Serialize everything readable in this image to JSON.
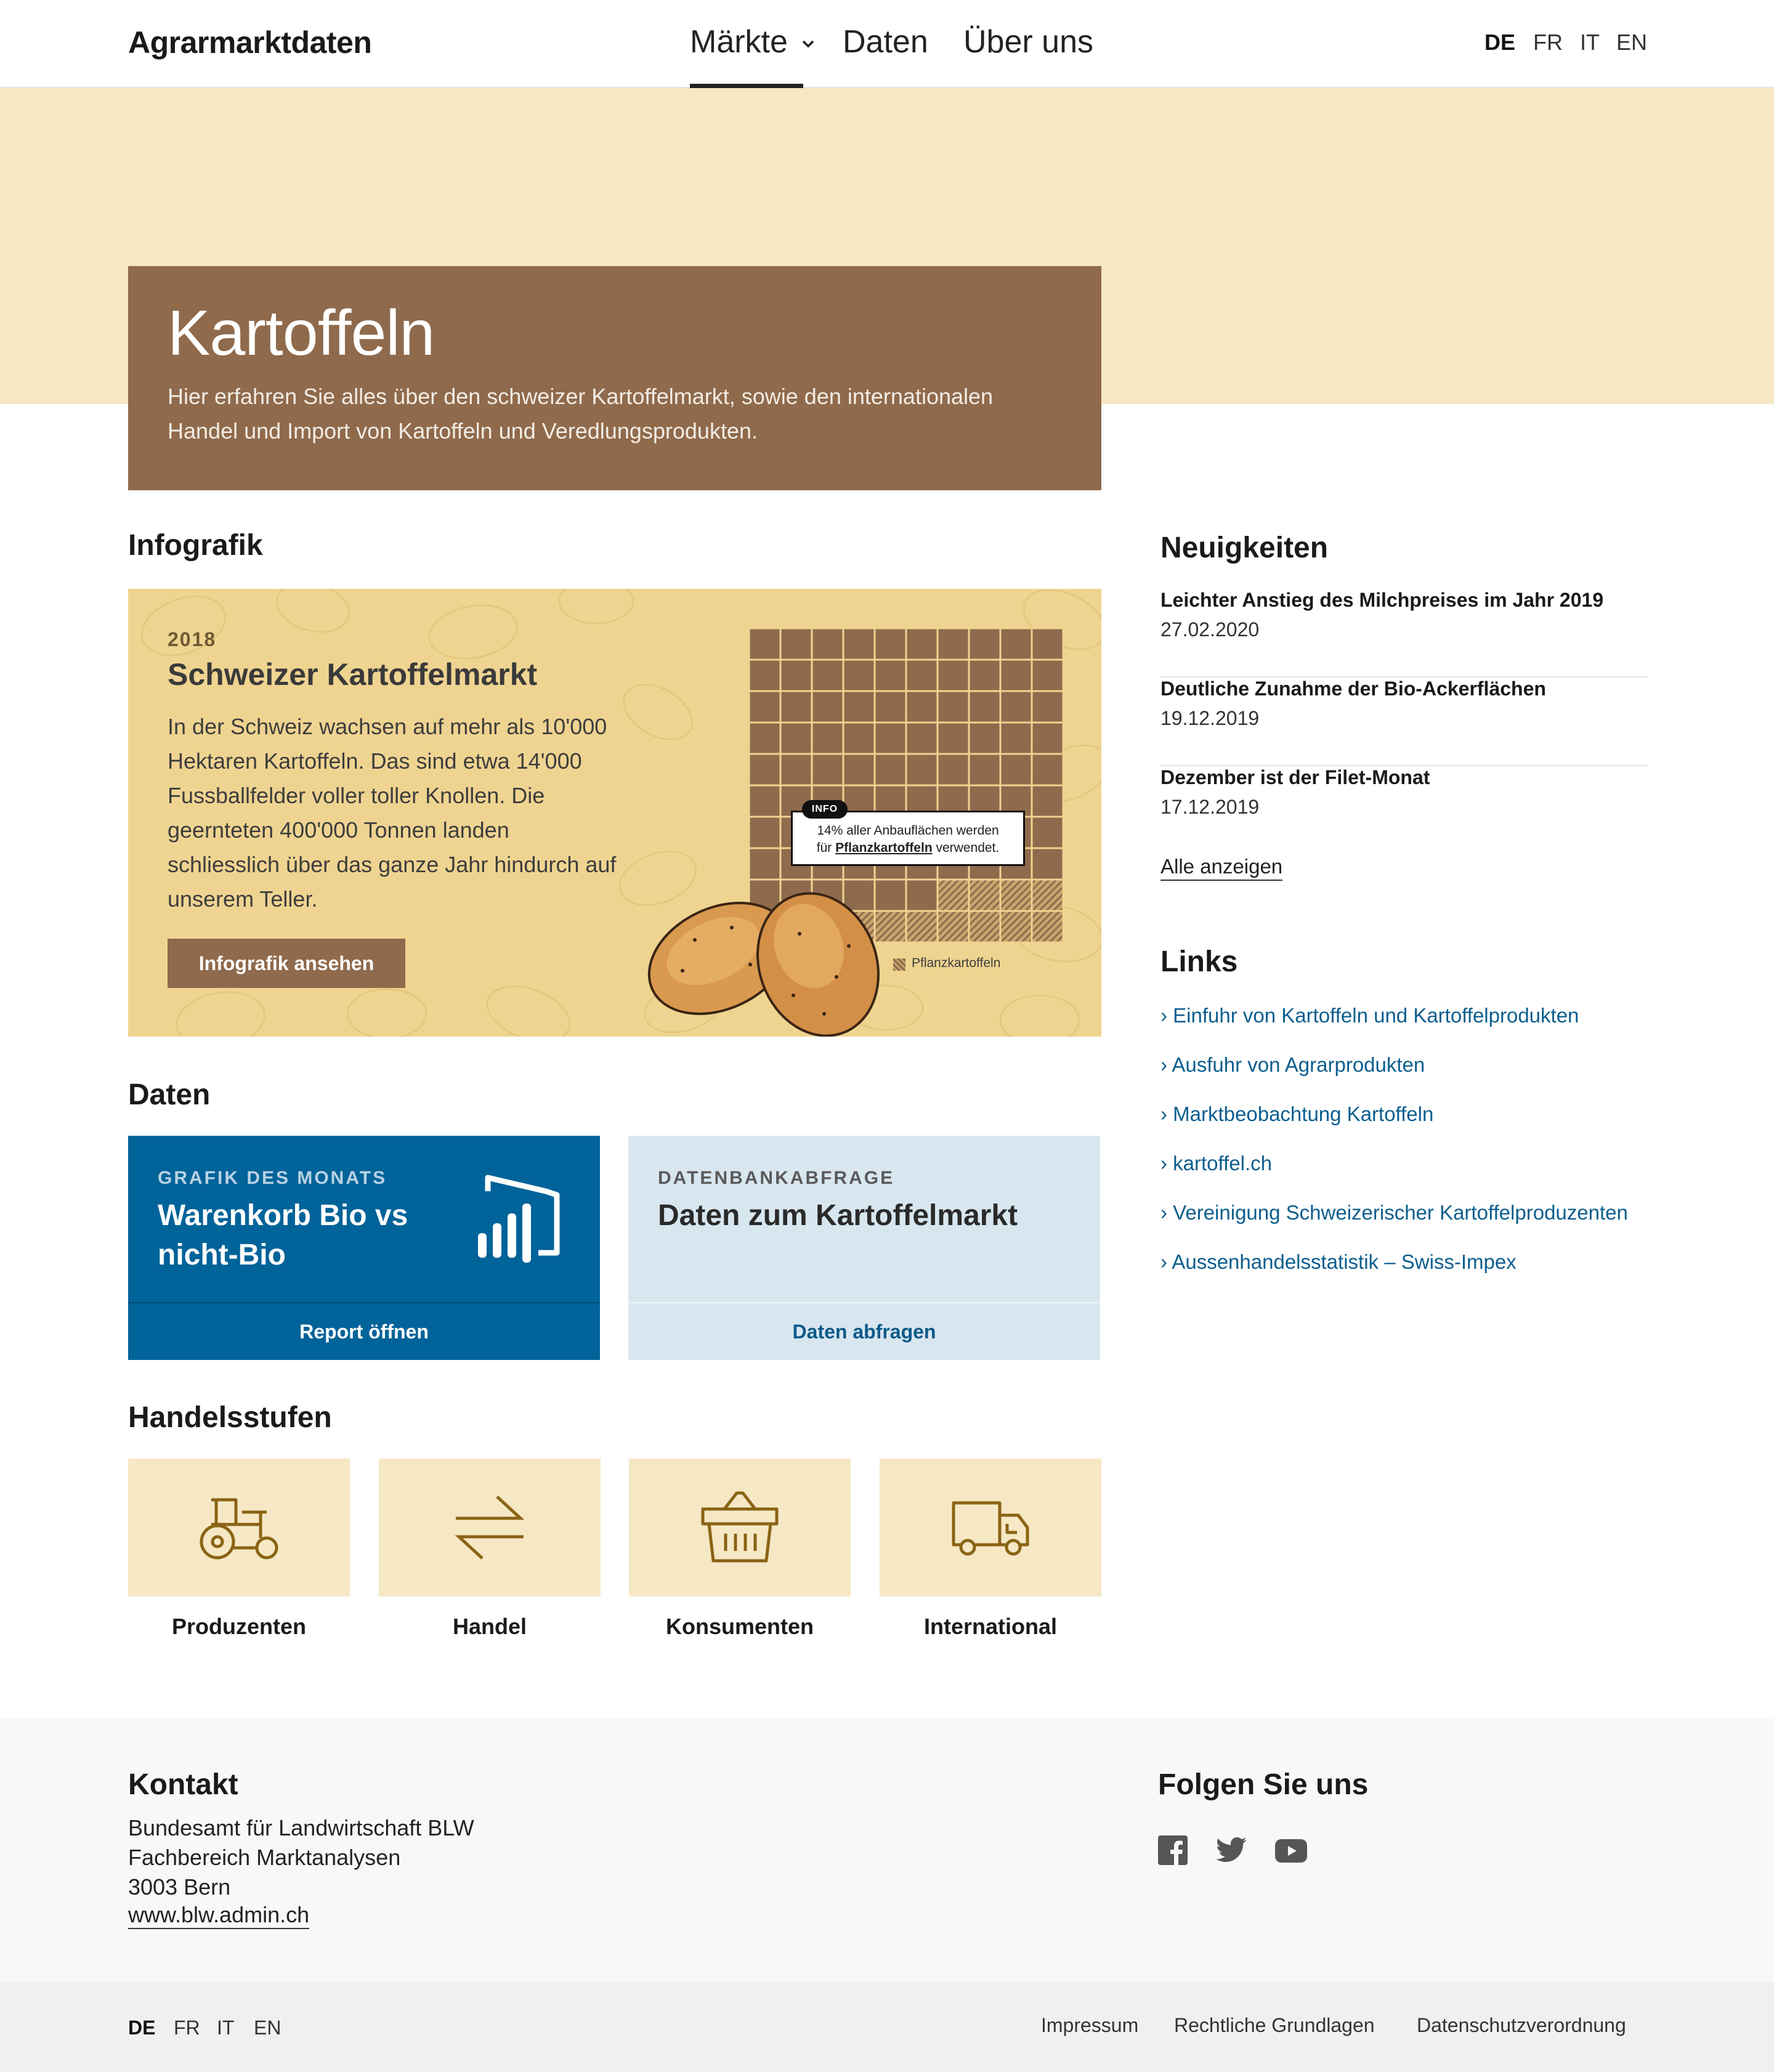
{
  "header": {
    "logo": "Agrarmarktdaten",
    "nav": [
      {
        "label": "Märkte"
      },
      {
        "label": "Daten"
      },
      {
        "label": "Über uns"
      }
    ],
    "languages": [
      "DE",
      "FR",
      "IT",
      "EN"
    ],
    "active_language": "DE"
  },
  "hero": {
    "title": "Kartoffeln",
    "description": "Hier erfahren Sie alles über den schweizer Kartoffelmarkt, sowie den internationalen Handel und Import von Kartoffeln und Veredlungsprodukten."
  },
  "infografik": {
    "section_title": "Infografik",
    "year": "2018",
    "title": "Schweizer Kartoffelmarkt",
    "text": "In der Schweiz wachsen auf mehr als 10'000 Hektaren Kartoffeln. Das sind etwa 14'000 Fussballfelder voller toller Knollen. Die geernteten 400'000 Tonnen landen schliesslich über das ganze Jahr hindurch auf unserem Teller.",
    "button": "Infografik ansehen",
    "info_tag": "INFO",
    "bubble_line1": "14% aller Anbauflächen werden",
    "bubble_prefix": "für",
    "bubble_bold": "Pflanzkartoffeln",
    "bubble_suffix": "verwendet.",
    "legend": "Pflanzkartoffeln",
    "grid_share_percent": 14,
    "colors": {
      "grid_fill": "#8f6a4c",
      "grid_line": "#efd491",
      "card_bg": "#efd491"
    }
  },
  "daten": {
    "section_title": "Daten",
    "card1": {
      "kicker": "GRAFIK DES MONATS",
      "title_line1": "Warenkorb Bio vs",
      "title_line2": "nicht-Bio",
      "button": "Report öffnen",
      "icon": "powerbi-icon",
      "color": "#006399"
    },
    "card2": {
      "kicker": "DATENBANKABFRAGE",
      "title": "Daten zum Kartoffelmarkt",
      "button": "Daten abfragen",
      "color": "#d8e6ef"
    }
  },
  "handelsstufen": {
    "section_title": "Handelsstufen",
    "items": [
      {
        "label": "Produzenten",
        "icon": "tractor-icon"
      },
      {
        "label": "Handel",
        "icon": "exchange-arrows-icon"
      },
      {
        "label": "Konsumenten",
        "icon": "shopping-basket-icon"
      },
      {
        "label": "International",
        "icon": "truck-icon"
      }
    ]
  },
  "sidebar": {
    "news_title": "Neuigkeiten",
    "news": [
      {
        "title": "Leichter Anstieg des Milchpreises im Jahr 2019",
        "date": "27.02.2020"
      },
      {
        "title": "Deutliche Zunahme der Bio-Ackerflächen",
        "date": "19.12.2019"
      },
      {
        "title": "Dezember ist der Filet-Monat",
        "date": "17.12.2019"
      }
    ],
    "all_label": "Alle anzeigen",
    "links_title": "Links",
    "links": [
      "Einfuhr von Kartoffeln und Kartoffelprodukten",
      "Ausfuhr von Agrarprodukten",
      "Marktbeobachtung Kartoffeln",
      "kartoffel.ch",
      "Vereinigung Schweizerischer Kartoffelproduzenten",
      "Aussenhandelsstatistik – Swiss-Impex"
    ]
  },
  "footer": {
    "kontakt_title": "Kontakt",
    "kontakt_lines": [
      "Bundesamt für Landwirtschaft BLW",
      "Fachbereich Marktanalysen",
      "3003 Bern"
    ],
    "kontakt_url": "www.blw.admin.ch",
    "follow_title": "Folgen Sie uns",
    "social_icons": [
      "facebook-icon",
      "twitter-icon",
      "youtube-icon"
    ],
    "languages": [
      "DE",
      "FR",
      "IT",
      "EN"
    ],
    "active_language": "DE",
    "legal_links": [
      "Impressum",
      "Rechtliche Grundlagen",
      "Datenschutzverordnung"
    ]
  }
}
